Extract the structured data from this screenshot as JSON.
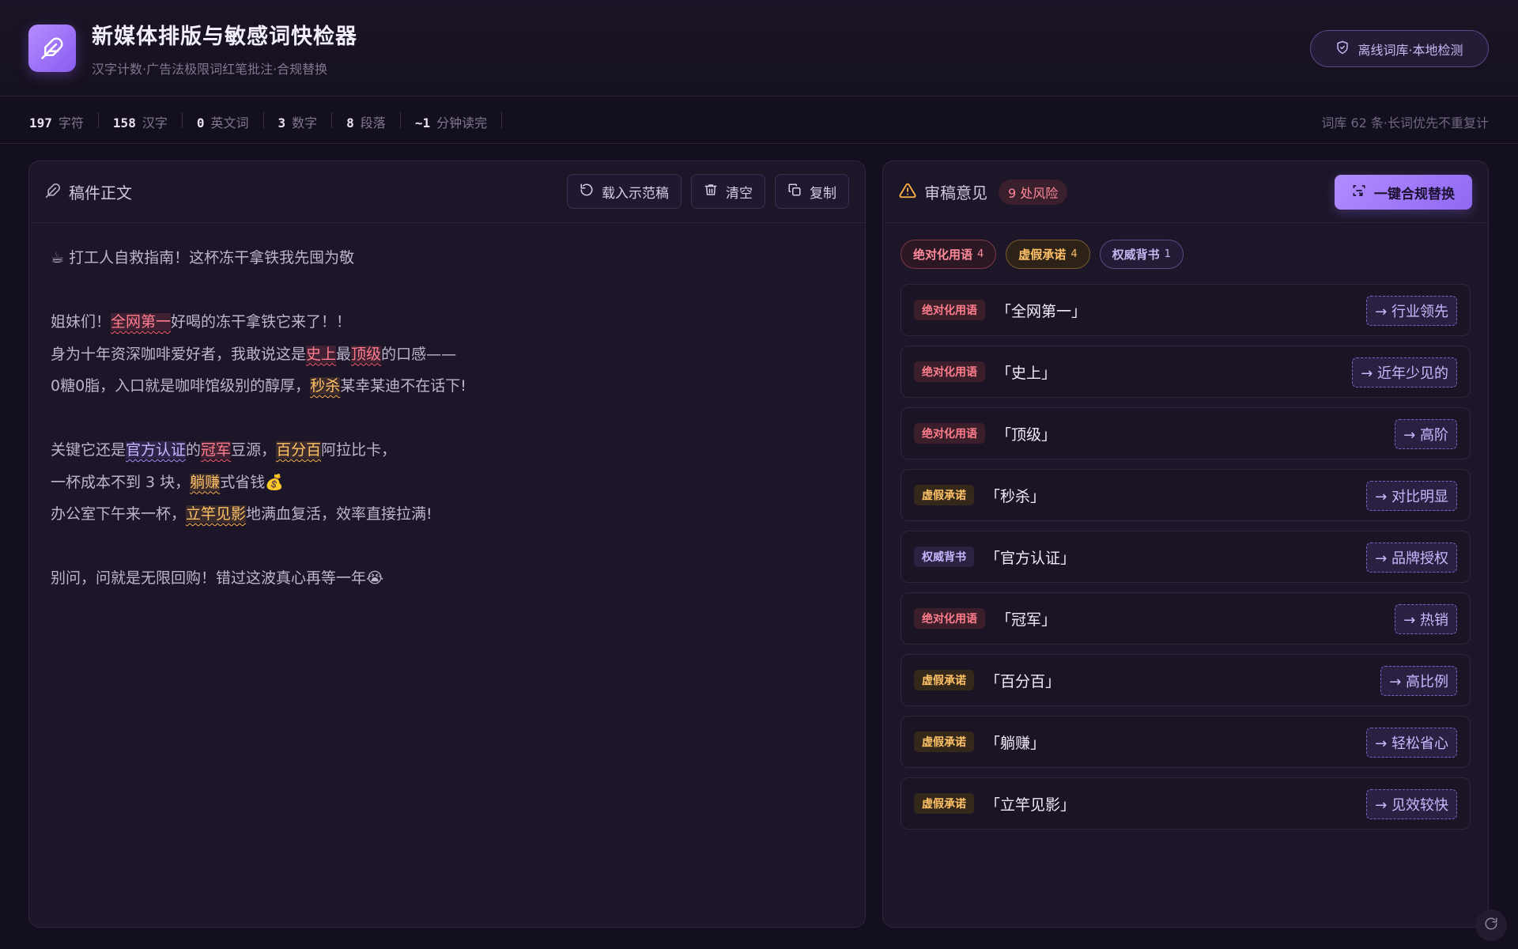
{
  "header": {
    "title": "新媒体排版与敏感词快检器",
    "subtitle": "汉字计数·广告法极限词红笔批注·合规替换",
    "offline_badge": "离线词库·本地检测"
  },
  "stats": {
    "items": [
      {
        "value": "197",
        "label": "字符"
      },
      {
        "value": "158",
        "label": "汉字"
      },
      {
        "value": "0",
        "label": "英文词"
      },
      {
        "value": "3",
        "label": "数字"
      },
      {
        "value": "8",
        "label": "段落"
      },
      {
        "value": "~1",
        "label": "分钟读完"
      }
    ],
    "note": "词库 62 条·长词优先不重复计"
  },
  "editor": {
    "title": "稿件正文",
    "buttons": {
      "load": "载入示范稿",
      "clear": "清空",
      "copy": "复制"
    },
    "lines": [
      {
        "segments": [
          {
            "t": "☕ 打工人自救指南！这杯冻干拿铁我先囤为敬"
          }
        ]
      },
      {
        "segments": []
      },
      {
        "segments": [
          {
            "t": "姐妹们！"
          },
          {
            "t": "全网第一",
            "k": "red"
          },
          {
            "t": "好喝的冻干拿铁它来了！！"
          }
        ]
      },
      {
        "segments": [
          {
            "t": "身为十年资深咖啡爱好者，我敢说这是"
          },
          {
            "t": "史上",
            "k": "red"
          },
          {
            "t": "最"
          },
          {
            "t": "顶级",
            "k": "red"
          },
          {
            "t": "的口感——"
          }
        ]
      },
      {
        "segments": [
          {
            "t": "0糖0脂，入口就是咖啡馆级别的醇厚，"
          },
          {
            "t": "秒杀",
            "k": "amber"
          },
          {
            "t": "某幸某迪不在话下!"
          }
        ]
      },
      {
        "segments": []
      },
      {
        "segments": [
          {
            "t": "关键它还是"
          },
          {
            "t": "官方认证",
            "k": "violet"
          },
          {
            "t": "的"
          },
          {
            "t": "冠军",
            "k": "red"
          },
          {
            "t": "豆源，"
          },
          {
            "t": "百分百",
            "k": "amber"
          },
          {
            "t": "阿拉比卡，"
          }
        ]
      },
      {
        "segments": [
          {
            "t": "一杯成本不到 3 块，"
          },
          {
            "t": "躺赚",
            "k": "amber"
          },
          {
            "t": "式省钱💰"
          }
        ]
      },
      {
        "segments": [
          {
            "t": "办公室下午来一杯，"
          },
          {
            "t": "立竿见影",
            "k": "amber"
          },
          {
            "t": "地满血复活，效率直接拉满!"
          }
        ]
      },
      {
        "segments": []
      },
      {
        "segments": [
          {
            "t": "别问，问就是无限回购！错过这波真心再等一年😭"
          }
        ]
      }
    ]
  },
  "review": {
    "title": "审稿意见",
    "risk_badge": "9 处风险",
    "replace_button": "一键合规替换",
    "chips": [
      {
        "label": "绝对化用语",
        "count": "4",
        "kind": "red"
      },
      {
        "label": "虚假承诺",
        "count": "4",
        "kind": "amber"
      },
      {
        "label": "权威背书",
        "count": "1",
        "kind": "violet"
      }
    ],
    "issues": [
      {
        "tag": "绝对化用语",
        "kind": "red",
        "term": "「全网第一」",
        "suggestion": "→ 行业领先"
      },
      {
        "tag": "绝对化用语",
        "kind": "red",
        "term": "「史上」",
        "suggestion": "→ 近年少见的"
      },
      {
        "tag": "绝对化用语",
        "kind": "red",
        "term": "「顶级」",
        "suggestion": "→ 高阶"
      },
      {
        "tag": "虚假承诺",
        "kind": "amber",
        "term": "「秒杀」",
        "suggestion": "→ 对比明显"
      },
      {
        "tag": "权威背书",
        "kind": "violet",
        "term": "「官方认证」",
        "suggestion": "→ 品牌授权"
      },
      {
        "tag": "绝对化用语",
        "kind": "red",
        "term": "「冠军」",
        "suggestion": "→ 热销"
      },
      {
        "tag": "虚假承诺",
        "kind": "amber",
        "term": "「百分百」",
        "suggestion": "→ 高比例"
      },
      {
        "tag": "虚假承诺",
        "kind": "amber",
        "term": "「躺赚」",
        "suggestion": "→ 轻松省心"
      },
      {
        "tag": "虚假承诺",
        "kind": "amber",
        "term": "「立竿见影」",
        "suggestion": "→ 见效较快"
      }
    ]
  },
  "colors": {
    "accent": "#9b74f5",
    "risk_red": "#ff7d8c",
    "risk_amber": "#ffc166",
    "risk_violet": "#c6b6ff",
    "background": "#140f1e"
  },
  "icons": {
    "logo": "feather-pen-icon",
    "offline": "shield-icon",
    "editor": "feather-pen-icon",
    "load": "rotate-icon",
    "clear": "trash-icon",
    "copy": "copy-icon",
    "review": "warning-triangle-icon",
    "replace": "scan-replace-icon",
    "corner": "refresh-icon"
  }
}
